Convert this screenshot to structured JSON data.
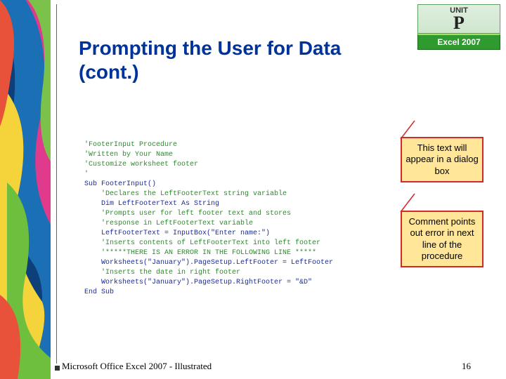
{
  "unit": {
    "label": "UNIT",
    "letter": "P",
    "product": "Excel 2007"
  },
  "title": "Prompting the User for Data (cont.)",
  "code": {
    "lines": [
      {
        "cls": "c",
        "indent": 0,
        "text": "'FooterInput Procedure"
      },
      {
        "cls": "c",
        "indent": 0,
        "text": "'Written by Your Name"
      },
      {
        "cls": "c",
        "indent": 0,
        "text": "'Customize worksheet footer"
      },
      {
        "cls": "c",
        "indent": 0,
        "text": "'"
      },
      {
        "cls": "k",
        "indent": 0,
        "text": "Sub FooterInput()"
      },
      {
        "cls": "c",
        "indent": 1,
        "text": "'Declares the LeftFooterText string variable"
      },
      {
        "cls": "k",
        "indent": 1,
        "text": "Dim LeftFooterText As String"
      },
      {
        "cls": "c",
        "indent": 1,
        "text": "'Prompts user for left footer text and stores"
      },
      {
        "cls": "c",
        "indent": 1,
        "text": "'response in LeftFooterText variable"
      },
      {
        "cls": "k",
        "indent": 1,
        "text": "LeftFooterText = InputBox(\"Enter name:\")"
      },
      {
        "cls": "c",
        "indent": 1,
        "text": "'Inserts contents of LeftFooterText into left footer"
      },
      {
        "cls": "c",
        "indent": 1,
        "text": "'*****THERE IS AN ERROR IN THE FOLLOWING LINE *****"
      },
      {
        "cls": "k",
        "indent": 1,
        "text": "Worksheets(\"January\").PageSetup.LeftFooter = LeftFooter"
      },
      {
        "cls": "c",
        "indent": 1,
        "text": "'Inserts the date in right footer"
      },
      {
        "cls": "k",
        "indent": 1,
        "text": "Worksheets(\"January\").PageSetup.RightFooter = \"&D\""
      },
      {
        "cls": "k",
        "indent": 0,
        "text": "End Sub"
      }
    ]
  },
  "callouts": {
    "c1": "This text will appear in a dialog box",
    "c2": "Comment points out error in next line of the procedure"
  },
  "footer": {
    "left": "Microsoft Office Excel 2007 - Illustrated",
    "page": "16"
  }
}
